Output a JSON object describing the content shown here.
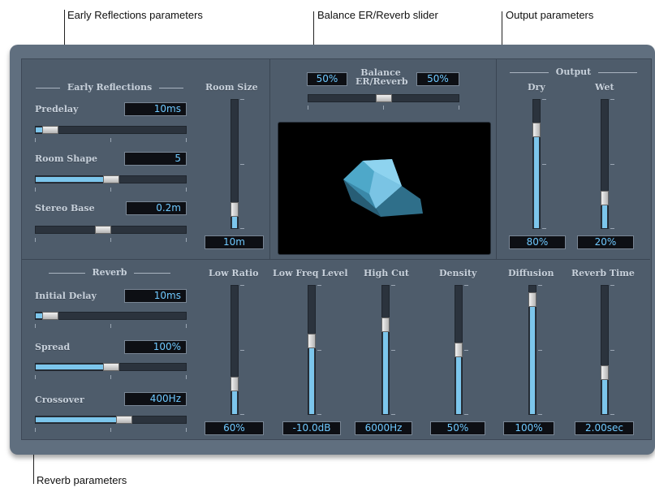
{
  "callouts": {
    "early_reflections": "Early Reflections parameters",
    "balance": "Balance ER/Reverb slider",
    "output": "Output parameters",
    "reverb": "Reverb parameters"
  },
  "early_reflections": {
    "title": "Early Reflections",
    "predelay": {
      "label": "Predelay",
      "value": "10ms",
      "level": 0.05
    },
    "room_shape": {
      "label": "Room Shape",
      "value": "5",
      "level": 0.5
    },
    "stereo_base": {
      "label": "Stereo Base",
      "value": "0.2m",
      "level": 0.44
    }
  },
  "room_size": {
    "label": "Room Size",
    "value": "10m",
    "level": 0.1
  },
  "balance": {
    "label_line1": "Balance",
    "label_line2": "ER/Reverb",
    "left_value": "50%",
    "right_value": "50%",
    "level": 0.5
  },
  "output": {
    "title": "Output",
    "dry": {
      "label": "Dry",
      "value": "80%",
      "level": 0.8
    },
    "wet": {
      "label": "Wet",
      "value": "20%",
      "level": 0.2
    }
  },
  "reverb": {
    "title": "Reverb",
    "initial_delay": {
      "label": "Initial Delay",
      "value": "10ms",
      "level": 0.05
    },
    "spread": {
      "label": "Spread",
      "value": "100%",
      "level": 0.5
    },
    "crossover": {
      "label": "Crossover",
      "value": "400Hz",
      "level": 0.6
    }
  },
  "vertical_params": [
    {
      "label": "Low Ratio",
      "value": "60%",
      "level": 0.2
    },
    {
      "label": "Low Freq Level",
      "value": "-10.0dB",
      "level": 0.58
    },
    {
      "label": "High Cut",
      "value": "6000Hz",
      "level": 0.72
    },
    {
      "label": "Density",
      "value": "50%",
      "level": 0.5
    },
    {
      "label": "Diffusion",
      "value": "100%",
      "level": 0.94
    },
    {
      "label": "Reverb Time",
      "value": "2.00sec",
      "level": 0.3
    }
  ],
  "colors": {
    "accent": "#7cc6ec",
    "panel": "#4e5c6b",
    "display_text": "#6fc9ff"
  }
}
